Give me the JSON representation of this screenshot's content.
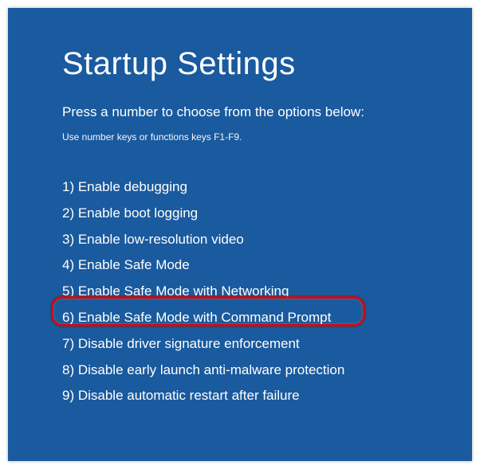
{
  "title": "Startup Settings",
  "subtitle": "Press a number to choose from the options below:",
  "hint": "Use number keys or functions keys F1-F9.",
  "options": [
    "1) Enable debugging",
    "2) Enable boot logging",
    "3) Enable low-resolution video",
    "4) Enable Safe Mode",
    "5) Enable Safe Mode with Networking",
    "6) Enable Safe Mode with Command Prompt",
    "7) Disable driver signature enforcement",
    "8) Disable early launch anti-malware protection",
    "9) Disable automatic restart after failure"
  ],
  "highlighted_index": 5
}
